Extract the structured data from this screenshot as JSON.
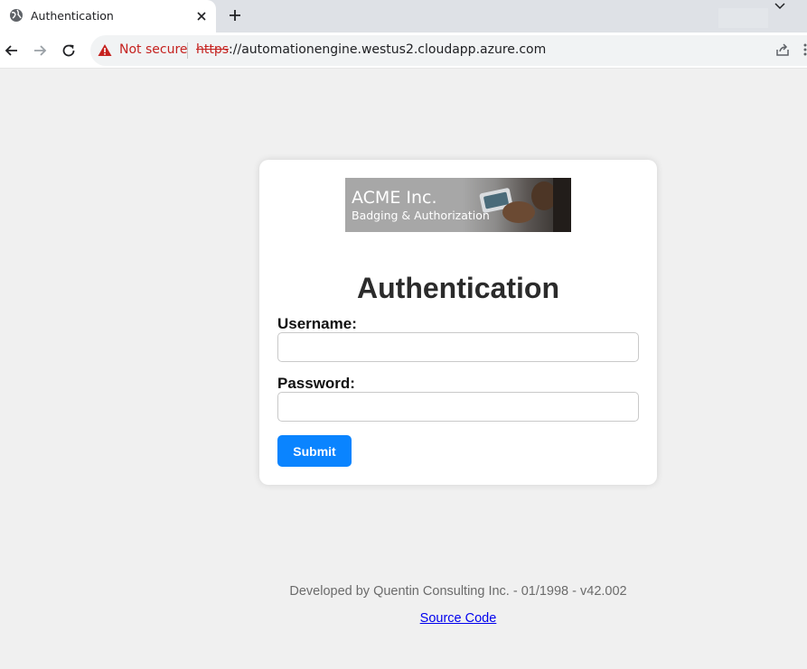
{
  "browser": {
    "tab": {
      "title": "Authentication"
    },
    "address_bar": {
      "security_text": "Not secure",
      "url_scheme": "https",
      "url_rest": "://automationengine.westus2.cloudapp.azure.com"
    }
  },
  "login": {
    "banner": {
      "title": "ACME Inc.",
      "subtitle": "Badging & Authorization"
    },
    "heading": "Authentication",
    "username_label": "Username:",
    "username_value": "",
    "password_label": "Password:",
    "password_value": "",
    "submit_label": "Submit"
  },
  "footer": {
    "credit": "Developed by Quentin Consulting Inc. - 01/1998 - v42.002",
    "source_link": "Source Code"
  },
  "colors": {
    "submit_button": "#0a84ff",
    "not_secure": "#c5221f",
    "page_background": "#f0f0f0"
  }
}
